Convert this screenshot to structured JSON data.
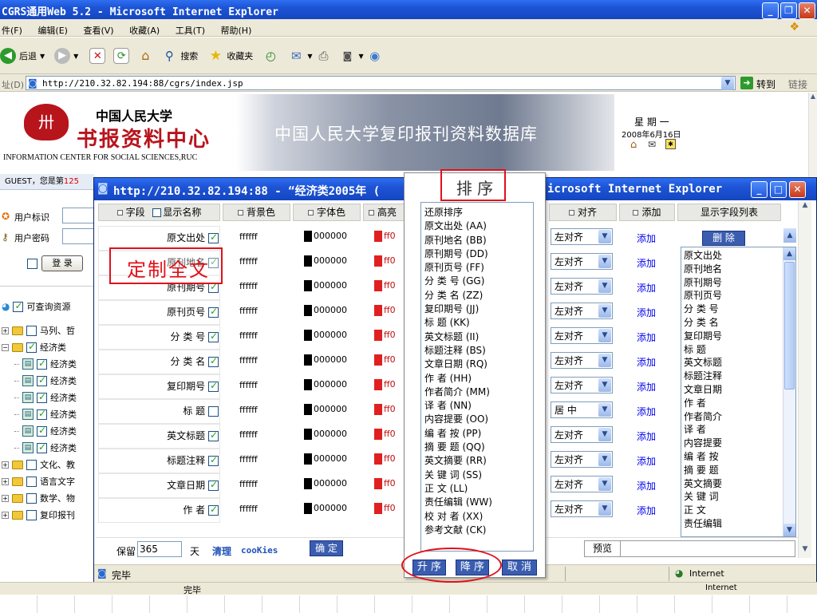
{
  "browser": {
    "title": "CGRS通用Web 5.2 - Microsoft Internet Explorer",
    "menu": [
      "件(F)",
      "编辑(E)",
      "查看(V)",
      "收藏(A)",
      "工具(T)",
      "帮助(H)"
    ],
    "back_label": "后退",
    "search_label": "搜索",
    "favorites_label": "收藏夹",
    "address_label": "址(D)",
    "address_url": "http://210.32.82.194:88/cgrs/index.jsp",
    "go_label": "转到",
    "links_label": "链接",
    "status_done": "完毕",
    "status_zone": "Internet"
  },
  "header": {
    "logo_top": "中国人民大学",
    "logo_main": "书报资料中心",
    "logo_sub": "INFORMATION CENTER FOR SOCIAL SCIENCES,RUC",
    "banner": "中国人民大学复印报刊资料数据库",
    "weekday": "星 期 一",
    "date": "2008年6月16日"
  },
  "sidebar": {
    "guest_text": "GUEST，您是第",
    "guest_count": "125",
    "user_label": "用户标识",
    "pass_label": "用户密码",
    "login_label": "登 录",
    "resources_label": "可查询资源",
    "tree": [
      {
        "label": "马列、哲",
        "level": 1,
        "checked": false
      },
      {
        "label": "经济类",
        "level": 1,
        "checked": true
      },
      {
        "label": "经济类",
        "level": 2,
        "checked": true
      },
      {
        "label": "经济类",
        "level": 2,
        "checked": true
      },
      {
        "label": "经济类",
        "level": 2,
        "checked": true
      },
      {
        "label": "经济类",
        "level": 2,
        "checked": true
      },
      {
        "label": "经济类",
        "level": 2,
        "checked": true
      },
      {
        "label": "经济类",
        "level": 2,
        "checked": true
      },
      {
        "label": "文化、教",
        "level": 1,
        "checked": false
      },
      {
        "label": "语言文字",
        "level": 1,
        "checked": false
      },
      {
        "label": "数学、物",
        "level": 1,
        "checked": false
      },
      {
        "label": "复印报刊",
        "level": 1,
        "checked": false
      }
    ]
  },
  "popup": {
    "title_left": "http://210.32.82.194:88 - “经济类2005年 (",
    "title_right": "icrosoft Internet Explorer",
    "headers": {
      "field": "字段",
      "display": "显示名称",
      "bg": "背景色",
      "font": "字体色",
      "high": "高亮",
      "align": "对齐",
      "add": "添加",
      "list": "显示字段列表"
    },
    "rows": [
      {
        "name": "原文出处",
        "checked": true,
        "bg": "ffffff",
        "font": "000000",
        "hl": "ff0",
        "align": "左对齐",
        "add": "添加"
      },
      {
        "name": "原刊地名",
        "checked": true,
        "bg": "ffffff",
        "font": "000000",
        "hl": "ff0",
        "align": "左对齐",
        "add": "添加"
      },
      {
        "name": "原刊期号",
        "checked": true,
        "bg": "ffffff",
        "font": "000000",
        "hl": "ff0",
        "align": "左对齐",
        "add": "添加"
      },
      {
        "name": "原刊页号",
        "checked": true,
        "bg": "ffffff",
        "font": "000000",
        "hl": "ff0",
        "align": "左对齐",
        "add": "添加"
      },
      {
        "name": "分 类 号",
        "checked": true,
        "bg": "ffffff",
        "font": "000000",
        "hl": "ff0",
        "align": "左对齐",
        "add": "添加"
      },
      {
        "name": "分 类 名",
        "checked": true,
        "bg": "ffffff",
        "font": "000000",
        "hl": "ff0",
        "align": "左对齐",
        "add": "添加"
      },
      {
        "name": "复印期号",
        "checked": true,
        "bg": "ffffff",
        "font": "000000",
        "hl": "ff0",
        "align": "左对齐",
        "add": "添加"
      },
      {
        "name": "标 题",
        "checked": false,
        "bg": "ffffff",
        "font": "000000",
        "hl": "ff0",
        "align": "居 中",
        "add": "添加"
      },
      {
        "name": "英文标题",
        "checked": true,
        "bg": "ffffff",
        "font": "000000",
        "hl": "ff0",
        "align": "左对齐",
        "add": "添加"
      },
      {
        "name": "标题注释",
        "checked": true,
        "bg": "ffffff",
        "font": "000000",
        "hl": "ff0",
        "align": "左对齐",
        "add": "添加"
      },
      {
        "name": "文章日期",
        "checked": true,
        "bg": "ffffff",
        "font": "000000",
        "hl": "ff0",
        "align": "左对齐",
        "add": "添加"
      },
      {
        "name": "作 者",
        "checked": true,
        "bg": "ffffff",
        "font": "000000",
        "hl": "ff0",
        "align": "左对齐",
        "add": "添加"
      }
    ],
    "delete_label": "删 除",
    "field_list": [
      "原文出处",
      "原刊地名",
      "原刊期号",
      "原刊页号",
      "分 类 号",
      "分 类 名",
      "复印期号",
      "标 题",
      "英文标题",
      "标题注释",
      "文章日期",
      "作 者",
      "作者简介",
      "译 者",
      "内容提要",
      "编 者 按",
      "摘 要 题",
      "英文摘要",
      "关 键 词",
      "正 文",
      "责任编辑"
    ],
    "keep_label": "保留",
    "keep_days": "365",
    "days_label": "天",
    "clear_label": "清理",
    "cookies_label": "cooKies",
    "ok_label": "确 定",
    "preview_label": "预览",
    "status_done": "完毕",
    "status_zone": "Internet"
  },
  "sort_panel": {
    "title": "排 序",
    "items": [
      "还原排序",
      "原文出处 (AA)",
      "原刊地名 (BB)",
      "原刊期号 (DD)",
      "原刊页号 (FF)",
      "分 类 号 (GG)",
      "分 类 名 (ZZ)",
      "复印期号 (JJ)",
      "标 题 (KK)",
      "英文标题 (II)",
      "标题注释 (BS)",
      "文章日期 (RQ)",
      "作 者 (HH)",
      "作者简介 (MM)",
      "译 者 (NN)",
      "内容提要 (OO)",
      "编 者 按 (PP)",
      "摘 要 题 (QQ)",
      "英文摘要 (RR)",
      "关 键 词 (SS)",
      "正 文 (LL)",
      "责任编辑 (WW)",
      "校 对 者 (XX)",
      "参考文献 (CK)"
    ],
    "asc_label": "升 序",
    "desc_label": "降 序",
    "cancel_label": "取 消"
  },
  "annotation": {
    "label": "定制全文"
  }
}
